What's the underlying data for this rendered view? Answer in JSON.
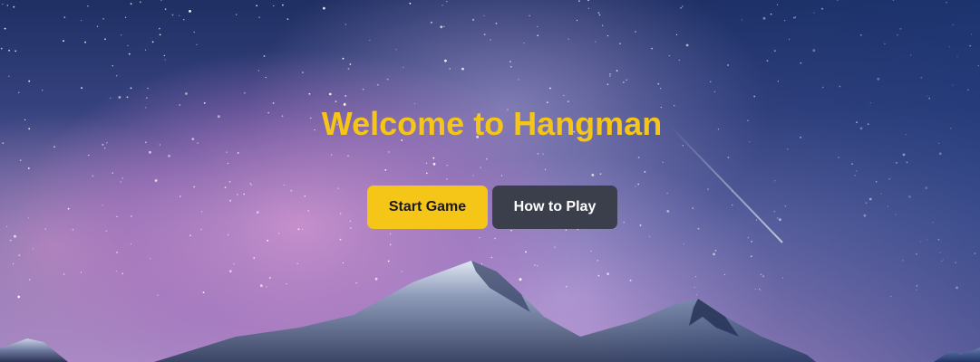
{
  "hero": {
    "title": "Welcome to Hangman",
    "start_label": "Start Game",
    "howto_label": "How to Play"
  },
  "colors": {
    "accent": "#f5c518",
    "secondary_button": "#3a3f4b",
    "title_text": "#f5c518"
  },
  "background": {
    "description_icon": "night-sky-mountains-image"
  }
}
